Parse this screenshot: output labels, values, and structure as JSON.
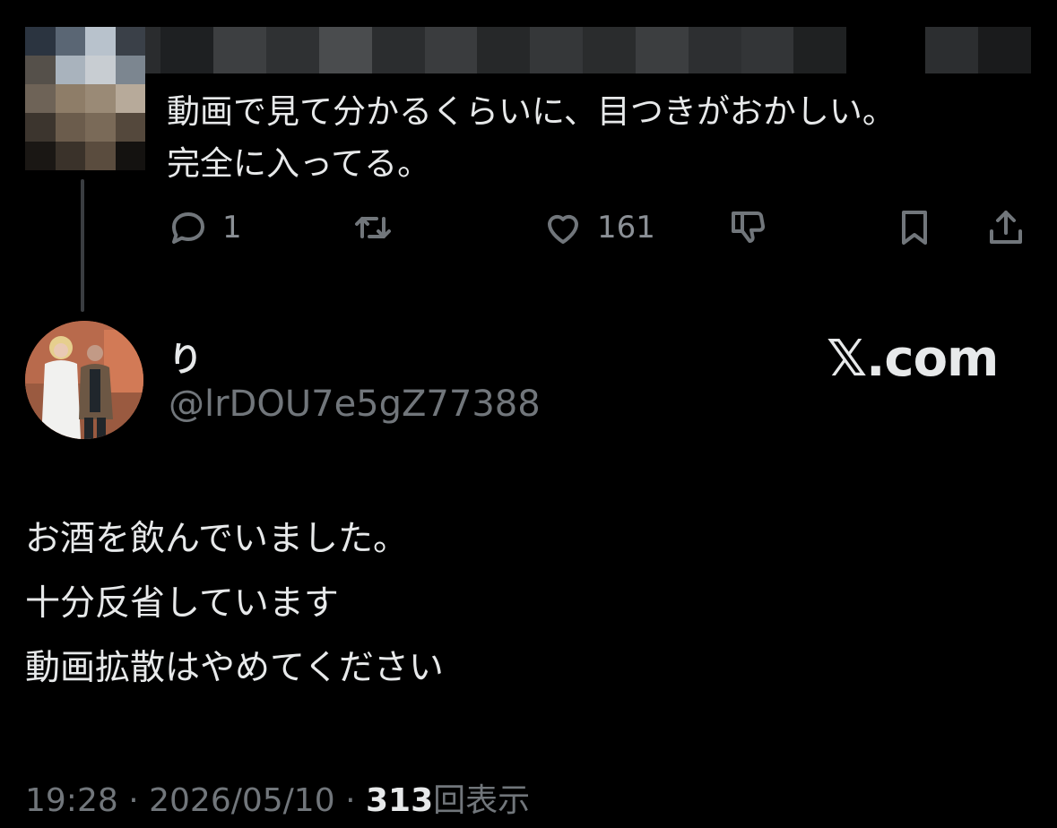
{
  "parent_tweet": {
    "text_lines": [
      "動画で見て分かるくらいに、目つきがおかしい。",
      "完全に入ってる。"
    ],
    "reply_count": "1",
    "like_count": "161"
  },
  "icons": {
    "reply": "reply-icon",
    "retweet": "retweet-icon",
    "like": "heart-icon",
    "dislike": "dislike-icon",
    "bookmark": "bookmark-icon",
    "share": "share-icon"
  },
  "main_tweet": {
    "display_name": "り",
    "handle": "@lrDOU7e5gZ77388",
    "text_lines": [
      "お酒を飲んでいました。",
      "十分反省しています",
      "動画拡散はやめてください"
    ],
    "time": "19:28",
    "date": "2026/05/10",
    "separator": "·",
    "view_count": "313",
    "view_label": "回表示"
  },
  "watermark": "𝕏.com",
  "colors": {
    "background": "#000000",
    "text": "#e7e9ea",
    "muted": "#71767b"
  }
}
